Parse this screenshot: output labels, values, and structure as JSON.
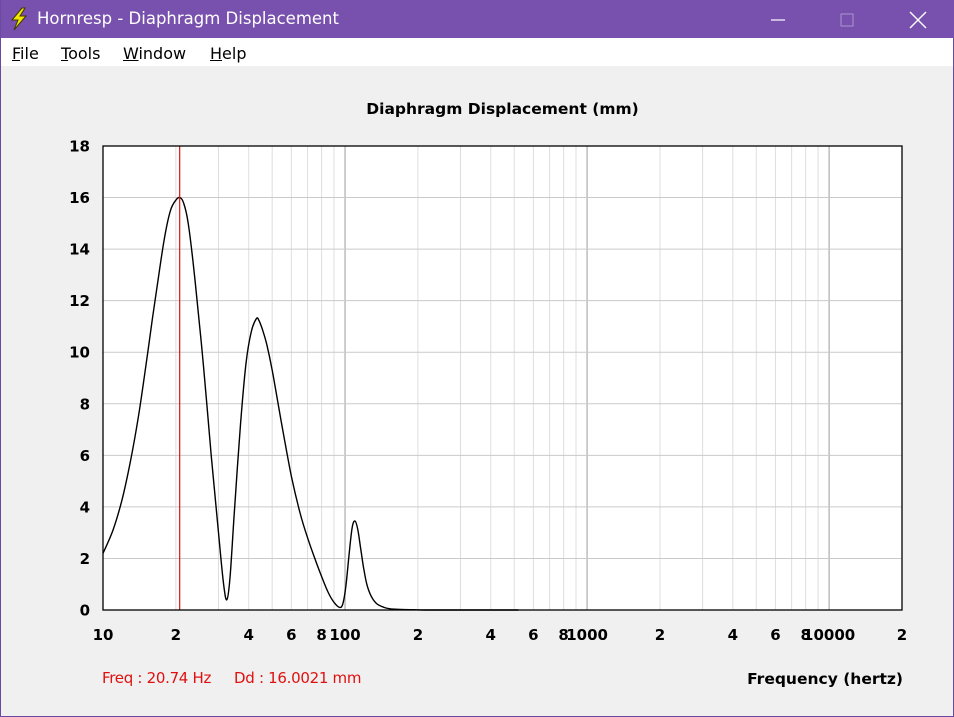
{
  "window": {
    "title": "Hornresp - Diaphragm Displacement"
  },
  "menu": {
    "items": [
      {
        "first": "F",
        "rest": "ile"
      },
      {
        "first": "T",
        "rest": "ools"
      },
      {
        "first": "W",
        "rest": "indow"
      },
      {
        "first": "H",
        "rest": "elp"
      }
    ]
  },
  "status": {
    "freq": "Freq : 20.74 Hz",
    "dd": "Dd : 16.0021 mm"
  },
  "colors": {
    "titlebar": "#7850ad",
    "trace": "#000000",
    "cursor": "#e01010",
    "grid": "#c8c8c8"
  },
  "chart_data": {
    "type": "line",
    "title": "Diaphragm Displacement (mm)",
    "xlabel": "Frequency (hertz)",
    "ylabel": "",
    "x_scale": "log",
    "xlim": [
      10,
      20000
    ],
    "ylim": [
      0,
      18
    ],
    "grid": true,
    "y_ticks": [
      "0",
      "2",
      "4",
      "6",
      "8",
      "10",
      "12",
      "14",
      "16",
      "18"
    ],
    "x_tick_labels": [
      {
        "x": 10,
        "label": "10"
      },
      {
        "x": 20,
        "label": "2"
      },
      {
        "x": 40,
        "label": "4"
      },
      {
        "x": 60,
        "label": "6"
      },
      {
        "x": 80,
        "label": "8"
      },
      {
        "x": 100,
        "label": "100"
      },
      {
        "x": 200,
        "label": "2"
      },
      {
        "x": 400,
        "label": "4"
      },
      {
        "x": 600,
        "label": "6"
      },
      {
        "x": 800,
        "label": "8"
      },
      {
        "x": 1000,
        "label": "1000"
      },
      {
        "x": 2000,
        "label": "2"
      },
      {
        "x": 4000,
        "label": "4"
      },
      {
        "x": 6000,
        "label": "6"
      },
      {
        "x": 8000,
        "label": "8"
      },
      {
        "x": 10000,
        "label": "10000"
      },
      {
        "x": 20000,
        "label": "2"
      }
    ],
    "cursor_x": 20.74,
    "series": [
      {
        "x": [
          10,
          11,
          12,
          13,
          14,
          15,
          16,
          17,
          18,
          19,
          20,
          20.74,
          21.5,
          22.5,
          24,
          26,
          28,
          30,
          31.5,
          32.5,
          33.5,
          35,
          37,
          39,
          41,
          43,
          44,
          45.5,
          47.5,
          50,
          55,
          60,
          65,
          70,
          75,
          80,
          85,
          90,
          95,
          98,
          101,
          104,
          107,
          110,
          113,
          116,
          119,
          123,
          128,
          135,
          145,
          155,
          170,
          190,
          220,
          260,
          300,
          400,
          500,
          520
        ],
        "y": [
          2.2,
          3.1,
          4.3,
          5.8,
          7.5,
          9.4,
          11.3,
          13.0,
          14.5,
          15.5,
          15.9,
          16.0,
          15.8,
          15.0,
          12.8,
          9.5,
          6.0,
          3.0,
          1.0,
          0.4,
          1.3,
          4.0,
          7.2,
          9.6,
          10.8,
          11.3,
          11.25,
          10.9,
          10.3,
          9.3,
          7.1,
          5.2,
          3.8,
          2.8,
          2.0,
          1.3,
          0.7,
          0.3,
          0.1,
          0.25,
          1.0,
          2.2,
          3.2,
          3.45,
          3.1,
          2.4,
          1.7,
          1.0,
          0.55,
          0.25,
          0.1,
          0.04,
          0.02,
          0.01,
          0.0,
          0.0,
          0.0,
          0.0,
          0.0,
          0.0
        ]
      }
    ]
  }
}
